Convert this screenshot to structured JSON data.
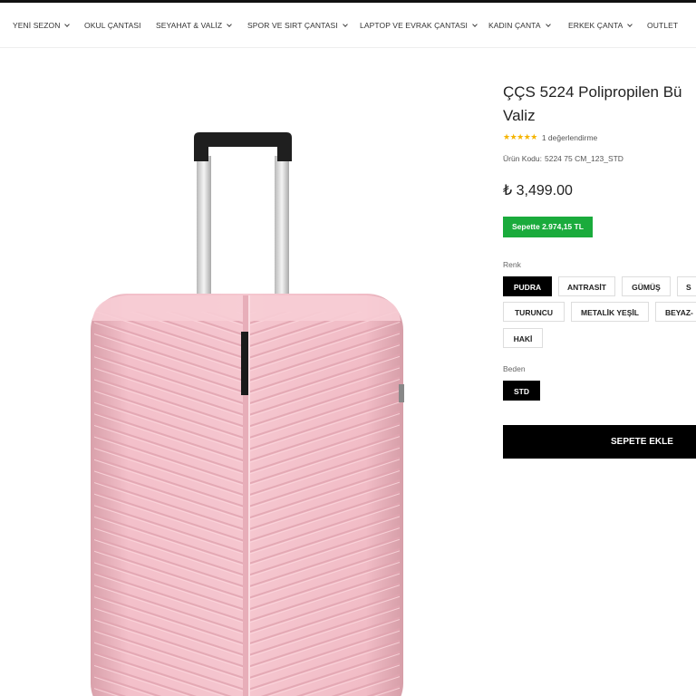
{
  "nav": {
    "items": [
      {
        "label": "YENİ SEZON",
        "has_dropdown": true
      },
      {
        "label": "OKUL ÇANTASI",
        "has_dropdown": false
      },
      {
        "label": "SEYAHAT & VALİZ",
        "has_dropdown": true
      },
      {
        "label": "SPOR VE SIRT ÇANTASI",
        "has_dropdown": true
      },
      {
        "label": "LAPTOP VE EVRAK ÇANTASI",
        "has_dropdown": true
      },
      {
        "label": "KADIN ÇANTA",
        "has_dropdown": true
      },
      {
        "label": "ERKEK ÇANTA",
        "has_dropdown": true
      },
      {
        "label": "OUTLET",
        "has_dropdown": false
      }
    ]
  },
  "product": {
    "title_line1": "ÇÇS 5224 Polipropilen Bü",
    "title_line2": "Valiz",
    "rating": {
      "stars": 5,
      "stars_glyph": "★★★★★",
      "count_text": "1 değerlendirme"
    },
    "sku_label": "Ürün Kodu:",
    "sku_value": "5224 75 CM_123_STD",
    "price": "₺ 3,499.00",
    "promo_text": "Sepette 2.974,15 TL",
    "image_color": "#f2bcc6",
    "color_label": "Renk",
    "colors": [
      {
        "label": "PUDRA",
        "selected": true
      },
      {
        "label": "ANTRASİT",
        "selected": false
      },
      {
        "label": "GÜMÜŞ",
        "selected": false
      },
      {
        "label": "S",
        "selected": false
      },
      {
        "label": "TURUNCU",
        "selected": false
      },
      {
        "label": "METALİK YEŞİL",
        "selected": false
      },
      {
        "label": "BEYAZ-",
        "selected": false
      },
      {
        "label": "HAKİ",
        "selected": false
      }
    ],
    "size_label": "Beden",
    "sizes": [
      {
        "label": "STD",
        "selected": true
      }
    ],
    "add_to_cart": "SEPETE EKLE"
  },
  "colors": {
    "accent_black": "#000000",
    "promo_green": "#1aab3c",
    "star_yellow": "#f5b400"
  }
}
